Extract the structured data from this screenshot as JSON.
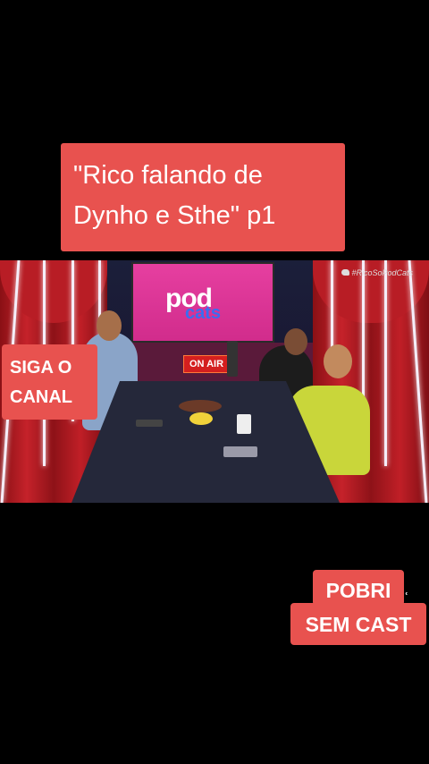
{
  "title_caption": {
    "line1": "\"Rico falando de",
    "line2": "Dynho e Sthe\" p1"
  },
  "video": {
    "screen_logo_top": "pod",
    "screen_logo_bottom": "cats",
    "on_air_sign": "ON AIR",
    "watermark": "#RicoSoPodCats"
  },
  "left_caption": {
    "line1": "SIGA O",
    "line2": "CANAL"
  },
  "right_caption": {
    "line1": "POBRI",
    "line2": "SEM CAST",
    "tail": "ʿ"
  },
  "colors": {
    "caption_bg": "#e8524f",
    "screen_pink": "#e63fa0",
    "curtain_red": "#c5222a"
  }
}
